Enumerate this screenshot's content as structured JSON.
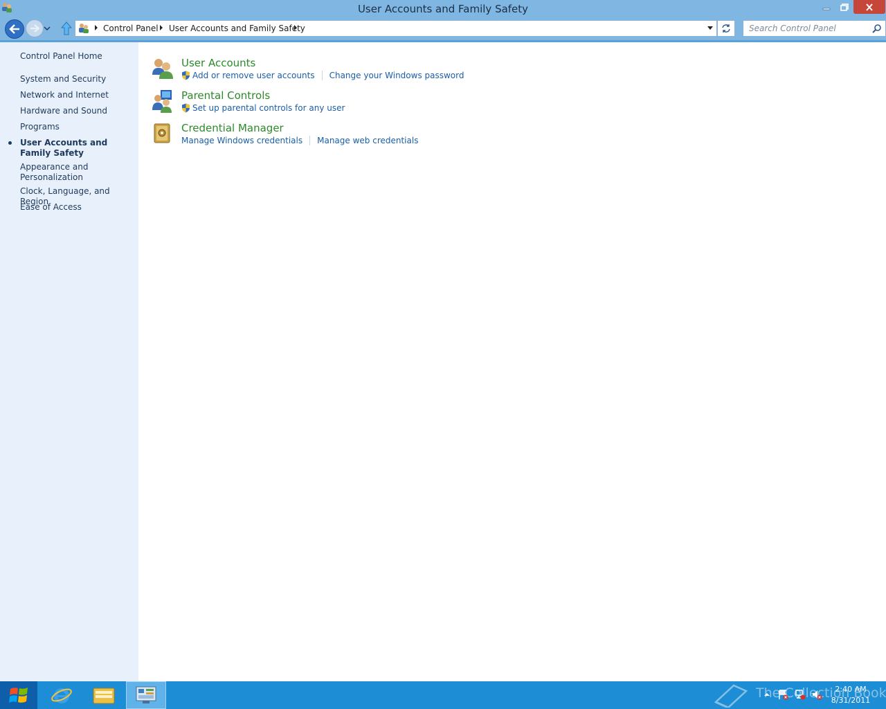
{
  "window": {
    "title": "User Accounts and Family Safety"
  },
  "address_bar": {
    "breadcrumbs": [
      "Control Panel",
      "User Accounts and Family Safety"
    ]
  },
  "search": {
    "placeholder": "Search Control Panel"
  },
  "sidebar": {
    "items": [
      {
        "label": "Control Panel Home",
        "current": false
      },
      {
        "label": "System and Security",
        "current": false
      },
      {
        "label": "Network and Internet",
        "current": false
      },
      {
        "label": "Hardware and Sound",
        "current": false
      },
      {
        "label": "Programs",
        "current": false
      },
      {
        "label": "User Accounts and Family Safety",
        "current": true
      },
      {
        "label": "Appearance and Personalization",
        "current": false
      },
      {
        "label": "Clock, Language, and Region",
        "current": false
      },
      {
        "label": "Ease of Access",
        "current": false
      }
    ]
  },
  "categories": [
    {
      "title": "User Accounts",
      "icon": "user-accounts-icon",
      "links": [
        {
          "label": "Add or remove user accounts",
          "shield": true
        },
        {
          "label": "Change your Windows password",
          "shield": false
        }
      ]
    },
    {
      "title": "Parental Controls",
      "icon": "parental-controls-icon",
      "links": [
        {
          "label": "Set up parental controls for any user",
          "shield": true
        }
      ]
    },
    {
      "title": "Credential Manager",
      "icon": "credential-manager-icon",
      "links": [
        {
          "label": "Manage Windows credentials",
          "shield": false
        },
        {
          "label": "Manage web credentials",
          "shield": false
        }
      ]
    }
  ],
  "taskbar": {
    "watermark": "The Collection Book",
    "clock_time": "2:40 AM",
    "clock_date": "8/31/2011"
  },
  "colors": {
    "titlebar": "#7fb6e2",
    "sidebar_bg": "#e8f1fb",
    "category_title": "#2c8a2a",
    "link": "#1a5ea8",
    "taskbar": "#1d8ed6"
  }
}
